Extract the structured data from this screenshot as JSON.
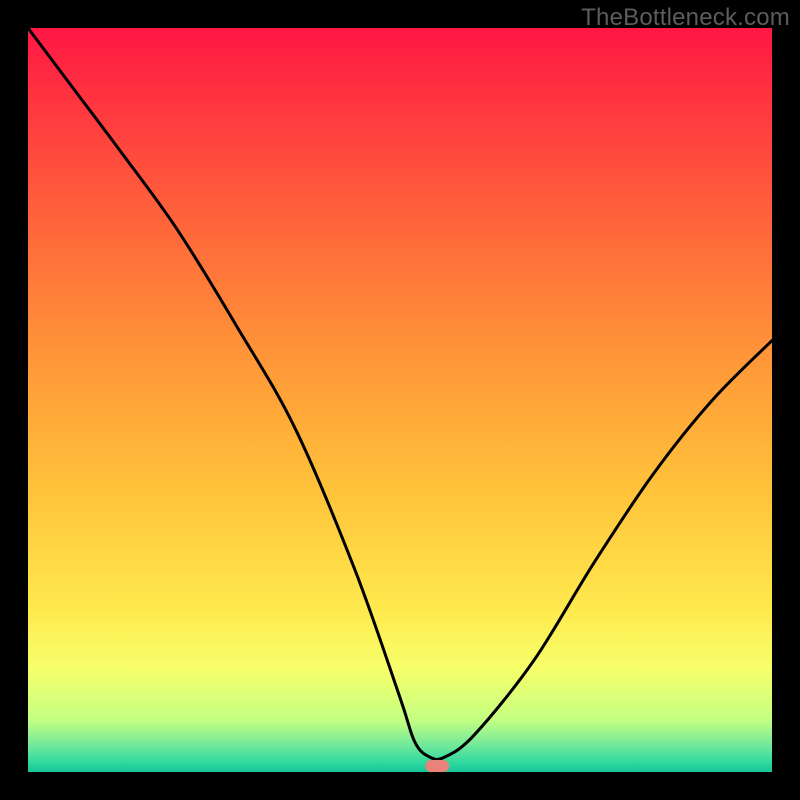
{
  "watermark": "TheBottleneck.com",
  "chart_data": {
    "type": "line",
    "title": "",
    "xlabel": "",
    "ylabel": "",
    "xlim": [
      0,
      100
    ],
    "ylim": [
      0,
      100
    ],
    "grid": false,
    "series": [
      {
        "name": "bottleneck-curve",
        "x": [
          0,
          6,
          12,
          20,
          28,
          36,
          44,
          50,
          52,
          54,
          56,
          60,
          68,
          76,
          84,
          92,
          100
        ],
        "y": [
          100,
          92,
          84,
          73,
          60,
          46,
          27,
          10,
          4,
          2,
          2,
          5,
          15,
          28,
          40,
          50,
          58
        ]
      }
    ],
    "marker": {
      "x": 55,
      "y": 0.8,
      "color": "#e8837a"
    },
    "background_gradient": {
      "stops": [
        {
          "offset": 0.0,
          "color": "#ff1744"
        },
        {
          "offset": 0.12,
          "color": "#ff3b3f"
        },
        {
          "offset": 0.28,
          "color": "#ff6a3a"
        },
        {
          "offset": 0.45,
          "color": "#ff9838"
        },
        {
          "offset": 0.62,
          "color": "#ffc23a"
        },
        {
          "offset": 0.78,
          "color": "#ffe94d"
        },
        {
          "offset": 0.86,
          "color": "#f7ff6a"
        },
        {
          "offset": 0.93,
          "color": "#c4ff82"
        },
        {
          "offset": 0.965,
          "color": "#6fe89b"
        },
        {
          "offset": 0.99,
          "color": "#29d69e"
        },
        {
          "offset": 1.0,
          "color": "#18c39a"
        }
      ]
    }
  }
}
